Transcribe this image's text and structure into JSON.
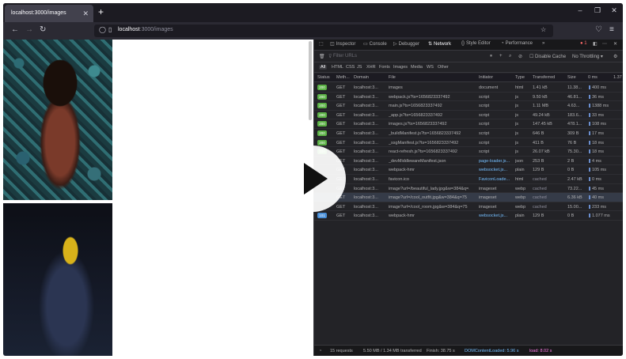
{
  "browser": {
    "tab_title": "localhost:3000/images",
    "new_tab": "+",
    "url_host": "localhost",
    "url_path": ":3000/images"
  },
  "devtools": {
    "tabs": [
      "Inspector",
      "Console",
      "Debugger",
      "Network",
      "Style Editor",
      "Performance"
    ],
    "active_tab": "Network",
    "error_count": "1",
    "filter_placeholder": "Filter URLs",
    "disable_cache": "Disable Cache",
    "throttling": "No Throttling",
    "types": [
      "All",
      "HTML",
      "CSS",
      "JS",
      "XHR",
      "Fonts",
      "Images",
      "Media",
      "WS",
      "Other"
    ],
    "columns": [
      "Status",
      "Meth...",
      "Domain",
      "File",
      "Initiator",
      "Type",
      "Transferred",
      "Size",
      "0 ms",
      "1.37"
    ],
    "rows": [
      {
        "status": "200",
        "method": "GET",
        "domain": "localhost:3...",
        "file": "images",
        "initiator": "document",
        "type": "html",
        "transferred": "1.41 kB",
        "size": "11.38...",
        "time": "400 ms"
      },
      {
        "status": "200",
        "method": "GET",
        "domain": "localhost:3...",
        "file": "webpack.js?ts=1656823337492",
        "initiator": "script",
        "type": "js",
        "transferred": "9.50 kB",
        "size": "46.81...",
        "time": "36 ms"
      },
      {
        "status": "200",
        "method": "GET",
        "domain": "localhost:3...",
        "file": "main.js?ts=1656823337492",
        "initiator": "script",
        "type": "js",
        "transferred": "1.11 MB",
        "size": "4.63...",
        "time": "1388 ms"
      },
      {
        "status": "200",
        "method": "GET",
        "domain": "localhost:3...",
        "file": "_app.js?ts=1656823337492",
        "initiator": "script",
        "type": "js",
        "transferred": "49.24 kB",
        "size": "183.6...",
        "time": "33 ms"
      },
      {
        "status": "200",
        "method": "GET",
        "domain": "localhost:3...",
        "file": "images.js?ts=1656823337492",
        "initiator": "script",
        "type": "js",
        "transferred": "147.45 kB",
        "size": "478.1...",
        "time": "108 ms"
      },
      {
        "status": "200",
        "method": "GET",
        "domain": "localhost:3...",
        "file": "_buildManifest.js?ts=1656823337492",
        "initiator": "script",
        "type": "js",
        "transferred": "646 B",
        "size": "309 B",
        "time": "17 ms"
      },
      {
        "status": "200",
        "method": "GET",
        "domain": "localhost:3...",
        "file": "_ssgManifest.js?ts=1656823337492",
        "initiator": "script",
        "type": "js",
        "transferred": "411 B",
        "size": "76 B",
        "time": "18 ms"
      },
      {
        "status": "200",
        "method": "GET",
        "domain": "localhost:3...",
        "file": "react-refresh.js?ts=1656823337492",
        "initiator": "script",
        "type": "js",
        "transferred": "26.07 kB",
        "size": "75.30...",
        "time": "18 ms"
      },
      {
        "status": "",
        "method": "GET",
        "domain": "localhost:3...",
        "file": "_devMiddlewareManifest.json",
        "initiator": "page-loader.js...",
        "type": "json",
        "transferred": "253 B",
        "size": "2 B",
        "time": "4 ms"
      },
      {
        "status": "",
        "method": "GET",
        "domain": "localhost:3...",
        "file": "webpack-hmr",
        "initiator": "websocket.js...",
        "type": "plain",
        "transferred": "129 B",
        "size": "0 B",
        "time": "105 ms"
      },
      {
        "status": "",
        "method": "GET",
        "domain": "localhost:3...",
        "file": "favicon.ico",
        "initiator": "FaviconLoade...",
        "type": "html",
        "transferred": "cached",
        "size": "2.47 kB",
        "time": "0 ms"
      },
      {
        "status": "",
        "method": "GET",
        "domain": "localhost:3...",
        "file": "image?url=/beautiful_lady.jpg&w=384&q=...",
        "initiator": "imageset",
        "type": "webp",
        "transferred": "cached",
        "size": "73.22...",
        "time": "45 ms"
      },
      {
        "status": "",
        "method": "GET",
        "domain": "localhost:3...",
        "file": "image?url=/cool_outfit.jpg&w=384&q=75",
        "initiator": "imageset",
        "type": "webp",
        "transferred": "cached",
        "size": "6.36 kB",
        "time": "40 ms"
      },
      {
        "status": "",
        "method": "GET",
        "domain": "localhost:3...",
        "file": "image?url=/cool_room.jpg&w=384&q=75",
        "initiator": "imageset",
        "type": "webp",
        "transferred": "cached",
        "size": "15.00...",
        "time": "233 ms"
      },
      {
        "status": "101",
        "method": "GET",
        "domain": "localhost:3...",
        "file": "webpack-hmr",
        "initiator": "websocket.js...",
        "type": "plain",
        "transferred": "129 B",
        "size": "0 B",
        "time": "1.077 ms"
      }
    ],
    "status_bar": {
      "requests": "15 requests",
      "transferred": "5.50 MB / 1.34 MB transferred",
      "finish": "Finish: 38.75 s",
      "dom_loaded": "DOMContentLoaded: 5.96 s",
      "load": "load: 8.02 s"
    }
  },
  "colors": {
    "ok_status": "#5bb145",
    "ws_status": "#4a90d9",
    "waterfall": "#6b8fcf"
  }
}
